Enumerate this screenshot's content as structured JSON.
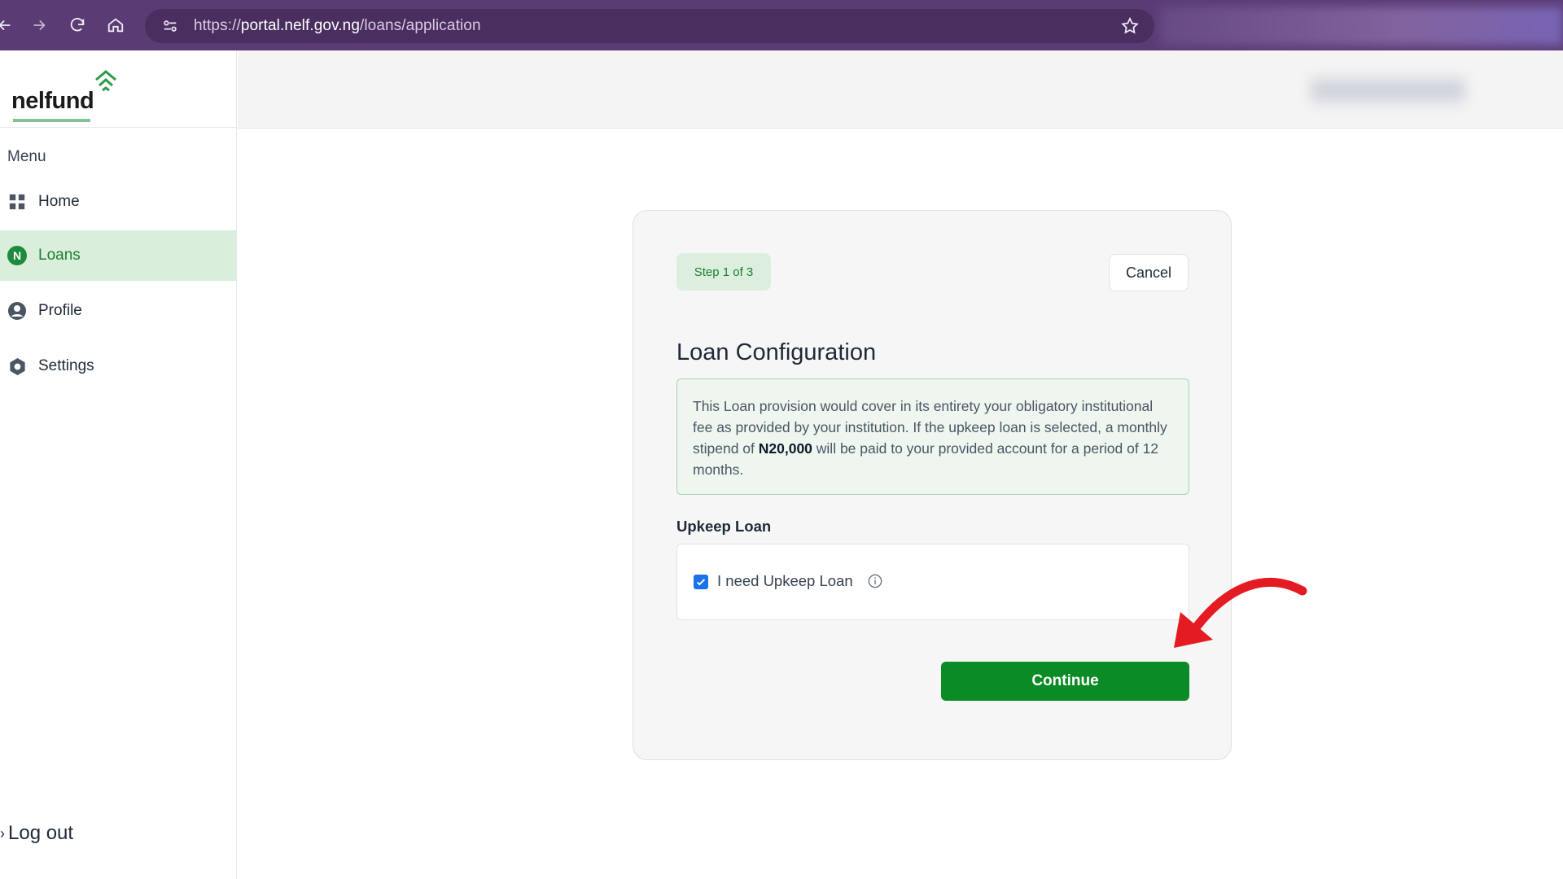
{
  "browser": {
    "url_prefix": "https://",
    "url_host": "portal.nelf.gov.ng",
    "url_path": "/loans/application"
  },
  "brand": {
    "name": "nelfund",
    "accent": "#1e8a3b",
    "primary_button": "#0a8b25"
  },
  "sidebar": {
    "menu_label": "Menu",
    "items": [
      {
        "label": "Home",
        "icon": "grid-icon",
        "active": false
      },
      {
        "label": "Loans",
        "icon": "naira-circle-icon",
        "badge": "N",
        "active": true
      },
      {
        "label": "Profile",
        "icon": "user-circle-icon",
        "active": false
      },
      {
        "label": "Settings",
        "icon": "gear-icon",
        "active": false
      }
    ],
    "logout_label": "Log out"
  },
  "card": {
    "step": "Step 1 of 3",
    "cancel_label": "Cancel",
    "title": "Loan Configuration",
    "info": {
      "part1": "This Loan provision would cover in its entirety your obligatory institutional fee as provided by your institution. If the upkeep loan is selected, a monthly stipend of ",
      "amount": "N20,000",
      "part2": " will be paid to your provided account for a period of 12 months."
    },
    "upkeep_section_label": "Upkeep Loan",
    "upkeep_checkbox_label": "I need Upkeep Loan",
    "upkeep_checked": true,
    "continue_label": "Continue"
  }
}
